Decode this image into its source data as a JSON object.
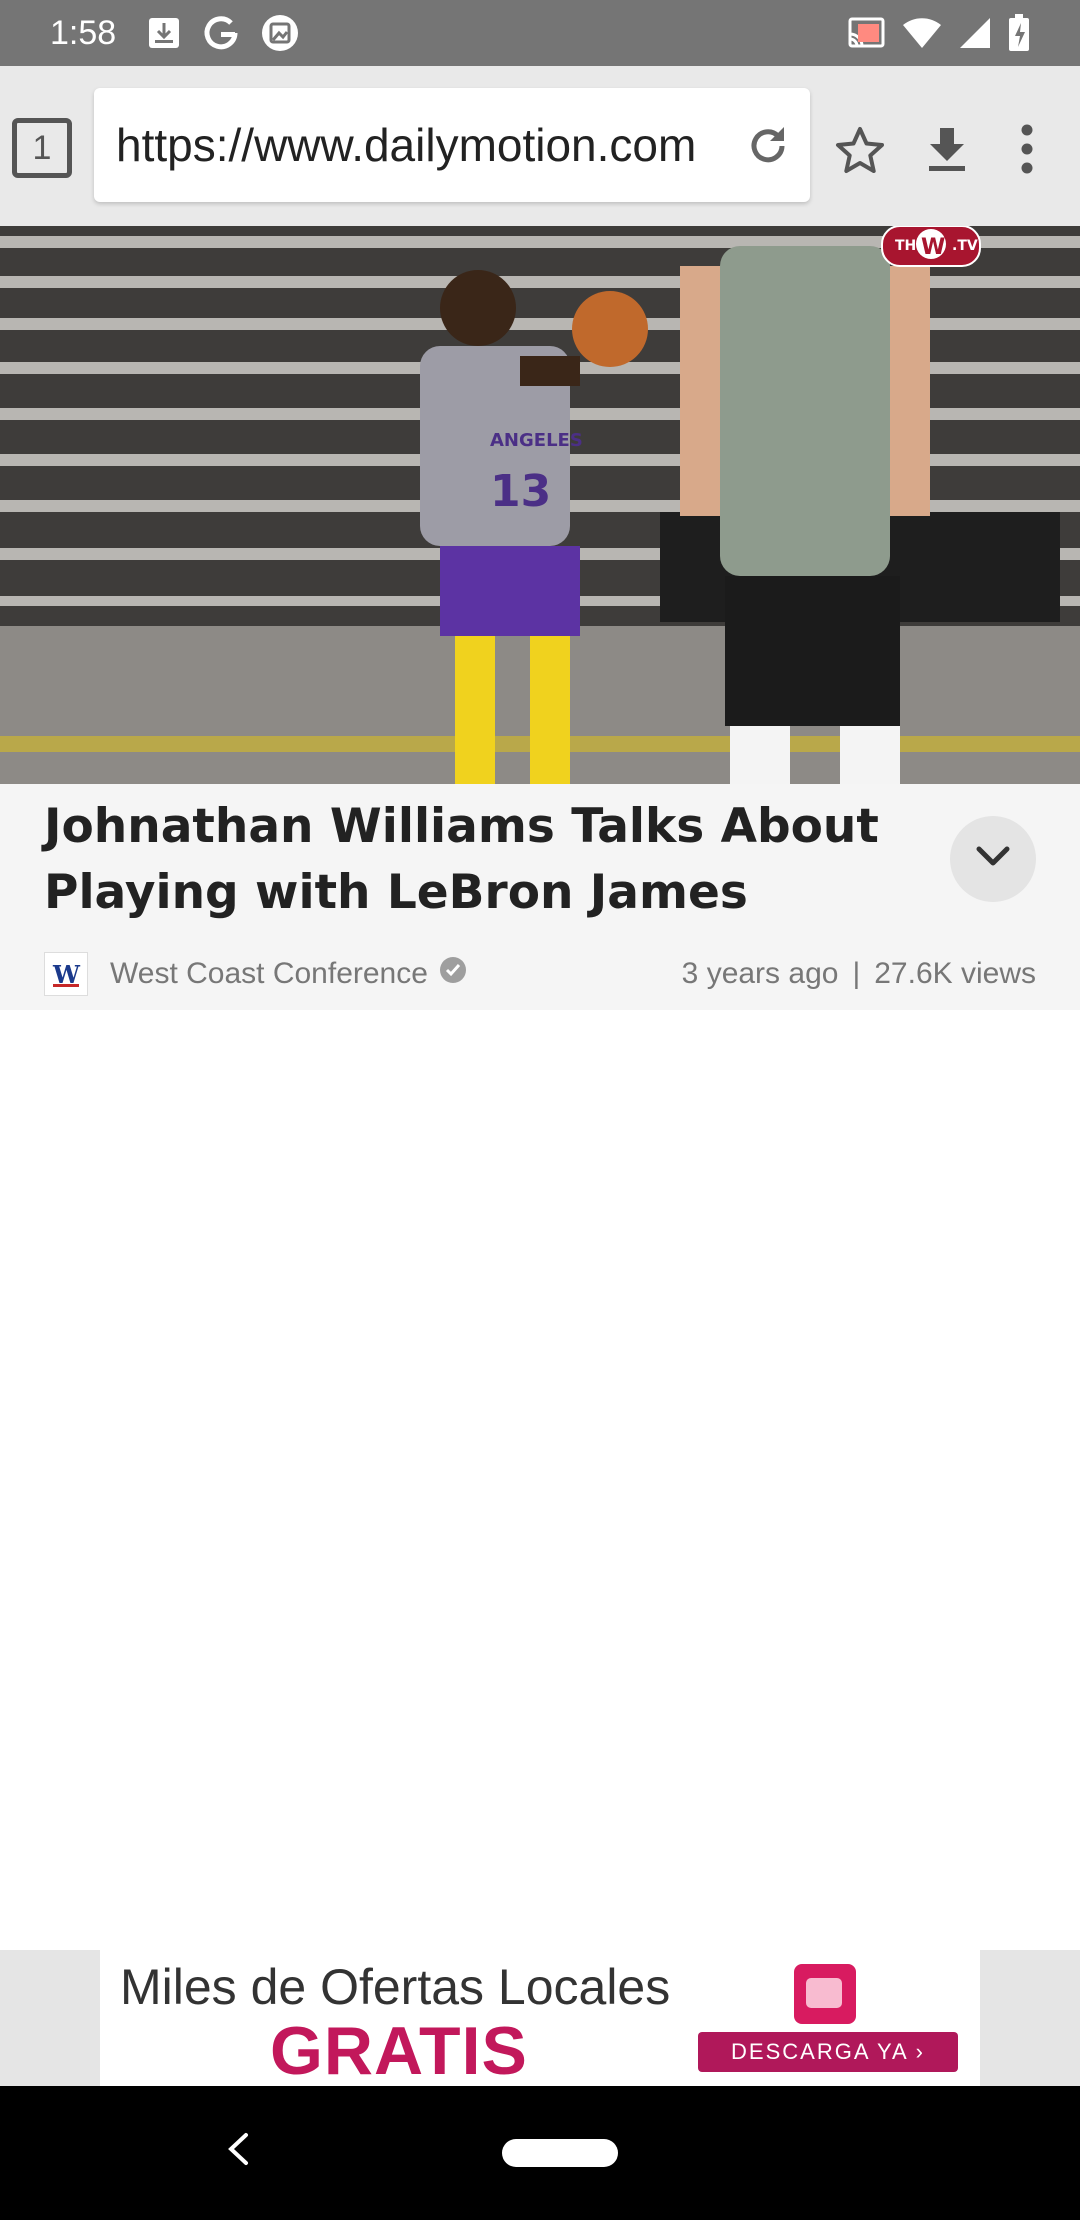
{
  "status_bar": {
    "time": "1:58",
    "left_icons": [
      "download-icon",
      "google-icon",
      "image-icon"
    ],
    "right_icons": [
      "cast-icon",
      "wifi-icon",
      "signal-icon",
      "battery-charging-icon"
    ]
  },
  "browser": {
    "tab_count": "1",
    "url": "https://www.dailymotion.com",
    "actions": [
      "reload-icon",
      "star-icon",
      "download-icon",
      "more-vert-icon"
    ]
  },
  "video": {
    "watermark": "THE W TV",
    "jersey_text": "ANGELES",
    "jersey_number": "13"
  },
  "details": {
    "title": "Johnathan Williams Talks About Playing with LeBron James",
    "channel": "West Coast Conference",
    "channel_logo_letter": "W",
    "age": "3 years ago",
    "separator": "|",
    "views": "27.6K views"
  },
  "ad": {
    "line1": "Miles de Ofertas Locales",
    "line2": "GRATIS",
    "cta": "DESCARGA YA ›"
  },
  "colors": {
    "status_bar": "#757575",
    "toolbar": "#e9e9e9",
    "ad_accent": "#c2185b"
  }
}
